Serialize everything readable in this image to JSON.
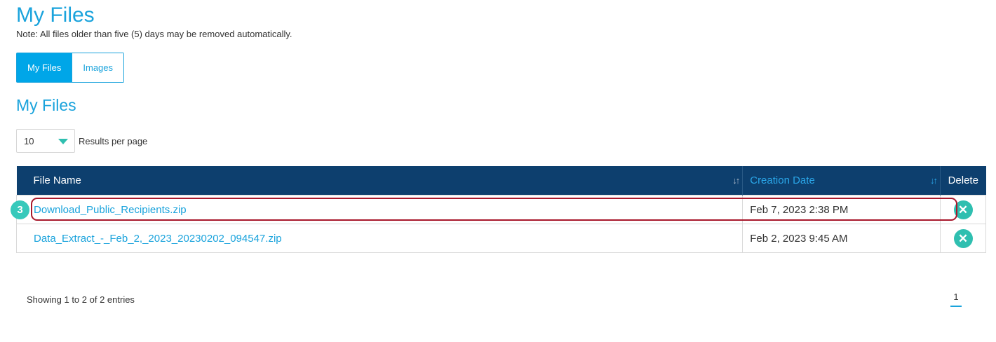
{
  "header": {
    "title": "My Files",
    "note": "Note: All files older than five (5) days may be removed automatically."
  },
  "tabs": [
    {
      "label": "My Files",
      "active": true
    },
    {
      "label": "Images",
      "active": false
    }
  ],
  "section": {
    "title": "My Files"
  },
  "pagination_controls": {
    "page_size": "10",
    "page_size_label": "Results per page"
  },
  "table": {
    "columns": [
      "File Name",
      "Creation Date",
      "Delete"
    ],
    "rows": [
      {
        "file_name": "Download_Public_Recipients.zip",
        "creation_date": "Feb 7, 2023 2:38 PM"
      },
      {
        "file_name": "Data_Extract_-_Feb_2,_2023_20230202_094547.zip",
        "creation_date": "Feb 2, 2023 9:45 AM"
      }
    ]
  },
  "annotation": {
    "step": "3"
  },
  "footer": {
    "showing": "Showing 1 to 2 of 2 entries",
    "current_page": "1"
  },
  "colors": {
    "accent": "#1aa3dc",
    "header_bg": "#0d3f6e",
    "delete_button": "#2fbfb0",
    "highlight": "#a8182b"
  },
  "icons": {
    "sort": "sort-icon",
    "delete": "delete-icon",
    "dropdown": "chevron-down-icon"
  }
}
